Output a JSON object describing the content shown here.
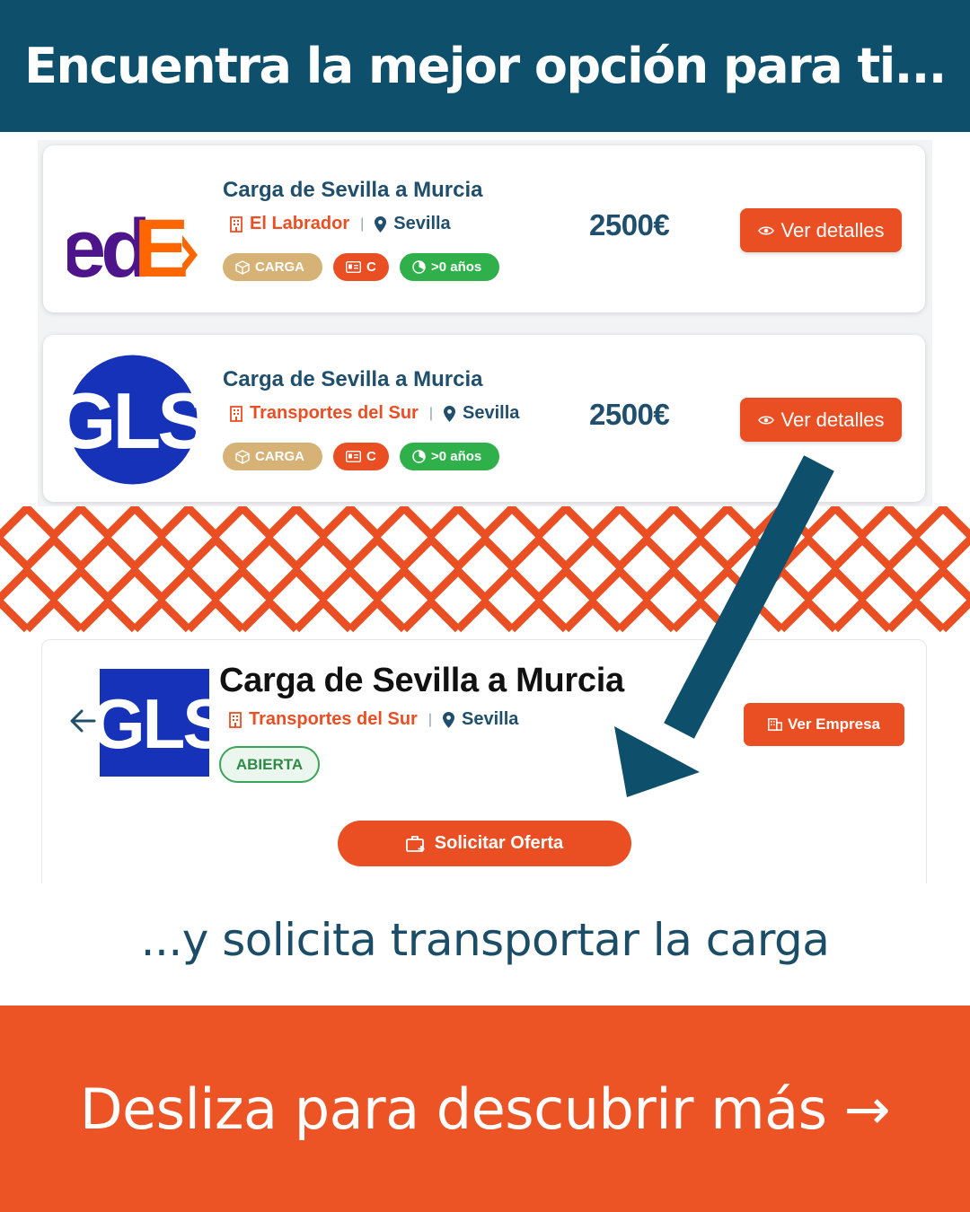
{
  "header": {
    "title": "Encuentra la mejor opción para ti..."
  },
  "listings": [
    {
      "title": "Carga de Sevilla a Murcia",
      "company": "El Labrador",
      "city": "Sevilla",
      "tags": {
        "cargo": "CARGA",
        "license": "C",
        "experience": ">0 años"
      },
      "price": "2500€",
      "button": "Ver detalles",
      "logo_text": "dE"
    },
    {
      "title": "Carga de Sevilla a Murcia",
      "company": "Transportes del Sur",
      "city": "Sevilla",
      "tags": {
        "cargo": "CARGA",
        "license": "C",
        "experience": ">0 años"
      },
      "price": "2500€",
      "button": "Ver detalles",
      "logo_text": "GLS"
    }
  ],
  "detail": {
    "title": "Carga de Sevilla a Murcia",
    "company": "Transportes del Sur",
    "city": "Sevilla",
    "status": "ABIERTA",
    "company_button": "Ver Empresa",
    "offer_button": "Solicitar Oferta",
    "logo_text": "GLS"
  },
  "subtitle": "...y solicita transportar la carga",
  "footer": {
    "cta": "Desliza para descubrir más →"
  },
  "colors": {
    "navy": "#0e4f6b",
    "orange": "#ea4f24",
    "tan": "#d6b276",
    "green": "#2fb04a",
    "gls_blue": "#1532b8",
    "fedex_purple": "#4d148c",
    "fedex_orange": "#ff6600"
  }
}
